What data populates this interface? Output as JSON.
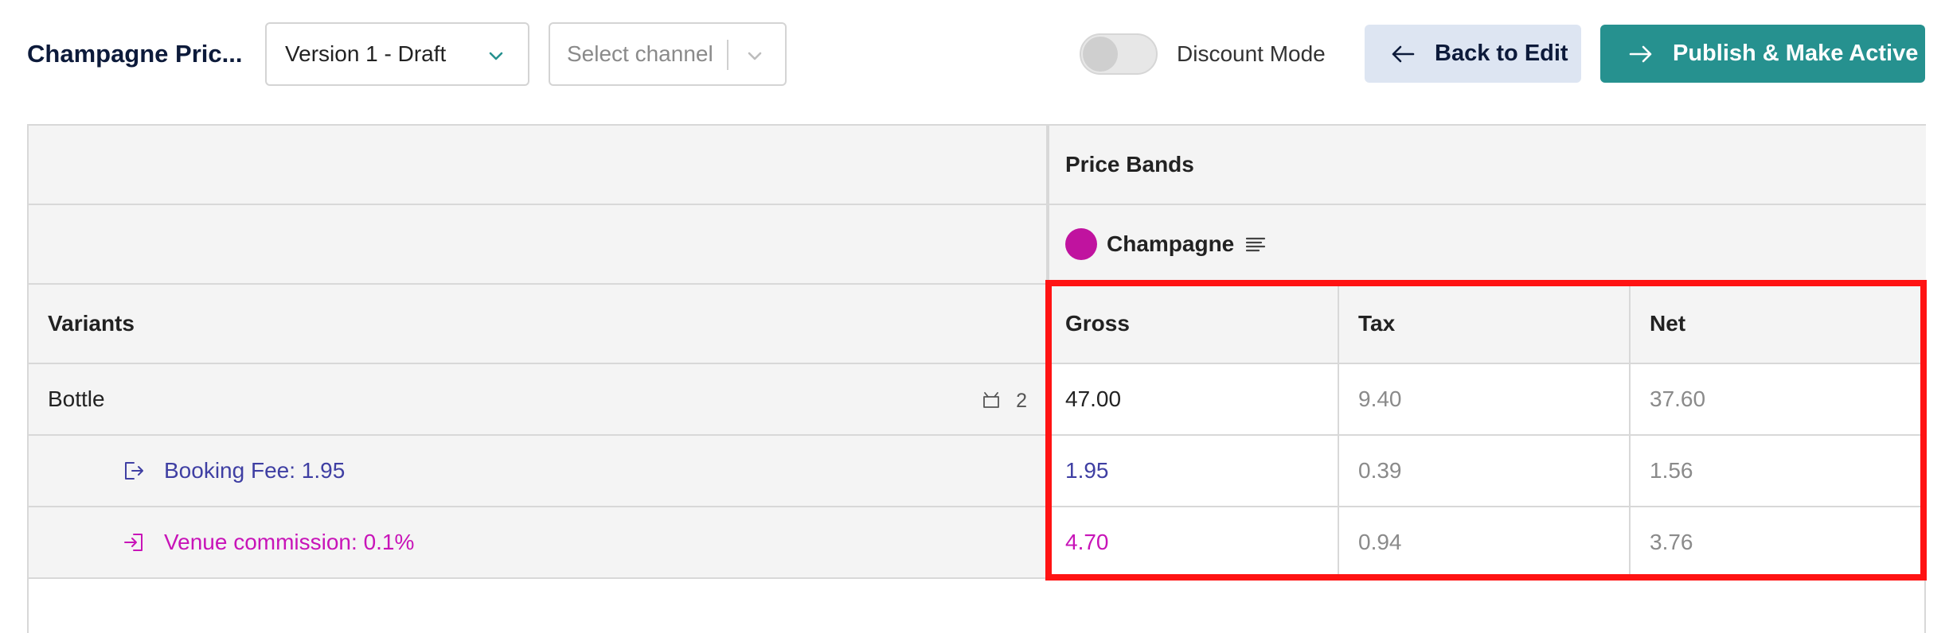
{
  "toolbar": {
    "title": "Champagne Pric...",
    "version_select": {
      "value": "Version 1 - Draft",
      "icon": "chevron-down-icon"
    },
    "channel_select": {
      "placeholder": "Select channel",
      "icon": "chevron-down-icon"
    },
    "discount_toggle": {
      "label": "Discount Mode",
      "on": false
    },
    "back_button": {
      "label": "Back to Edit",
      "icon": "arrow-left-icon"
    },
    "publish_button": {
      "label": "Publish & Make Active",
      "icon": "arrow-right-icon"
    }
  },
  "grid": {
    "band_header": "Price Bands",
    "band": {
      "name": "Champagne",
      "color": "#c0139f",
      "icon": "lines-icon"
    },
    "variants_header": "Variants",
    "columns": [
      "Gross",
      "Tax",
      "Net"
    ],
    "rows": [
      {
        "label": "Bottle",
        "icon": "sale-channel-icon",
        "count": "2",
        "gross": "47.00",
        "tax": "9.40",
        "net": "37.60"
      },
      {
        "label": "Booking Fee: 1.95",
        "icon": "fee-out-icon",
        "gross": "1.95",
        "tax": "0.39",
        "net": "1.56"
      },
      {
        "label": "Venue commission: 0.1%",
        "icon": "fee-in-icon",
        "gross": "4.70",
        "tax": "0.94",
        "net": "3.76"
      }
    ]
  },
  "colors": {
    "primary": "#26918f",
    "secondary": "#dde5f2",
    "fee": "#3f3fa3",
    "commission": "#c814b8",
    "highlight": "#ff1313"
  }
}
